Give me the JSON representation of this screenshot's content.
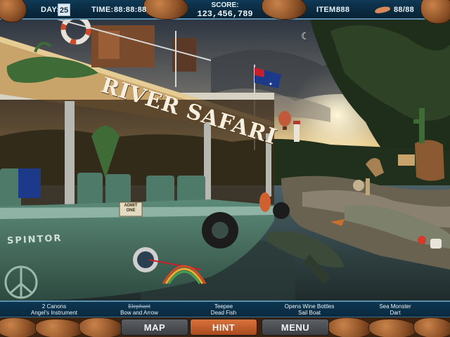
{
  "hud": {
    "day_label": "DAY:",
    "day_value": "25",
    "time_label": "TIME:",
    "time_value": "88:88:88",
    "score_label": "SCORE:",
    "score_value": "123,456,789",
    "item_label": "ITEM:",
    "item_value": "888",
    "item_counter": "88/88",
    "item_icon": "dart-icon"
  },
  "scene": {
    "boat_sign": "RIVER SAFARI",
    "hull_name": "SPINTOR",
    "ticket_line1": "ADMIT",
    "ticket_line2": "ONE"
  },
  "find_list": [
    {
      "top": "2 Canons",
      "bottom": "Angel's Instrument",
      "top_found": false
    },
    {
      "top": "Elephant",
      "bottom": "Bow and Arrow",
      "top_found": true
    },
    {
      "top": "Teepee",
      "bottom": "Dead Fish",
      "top_found": false
    },
    {
      "top": "Opens Wine Bottles",
      "bottom": "Sail Boat",
      "top_found": false
    },
    {
      "top": "Sea Monster",
      "bottom": "Dart",
      "top_found": false
    }
  ],
  "buttons": {
    "map": "MAP",
    "hint": "HINT",
    "menu": "MENU"
  },
  "colors": {
    "hud_blue": "#0a2a40",
    "hud_border": "#5b8fb0",
    "hint_orange": "#d9733c",
    "boat_green": "#4e7a6a",
    "sign_tan": "#c9a46a"
  }
}
